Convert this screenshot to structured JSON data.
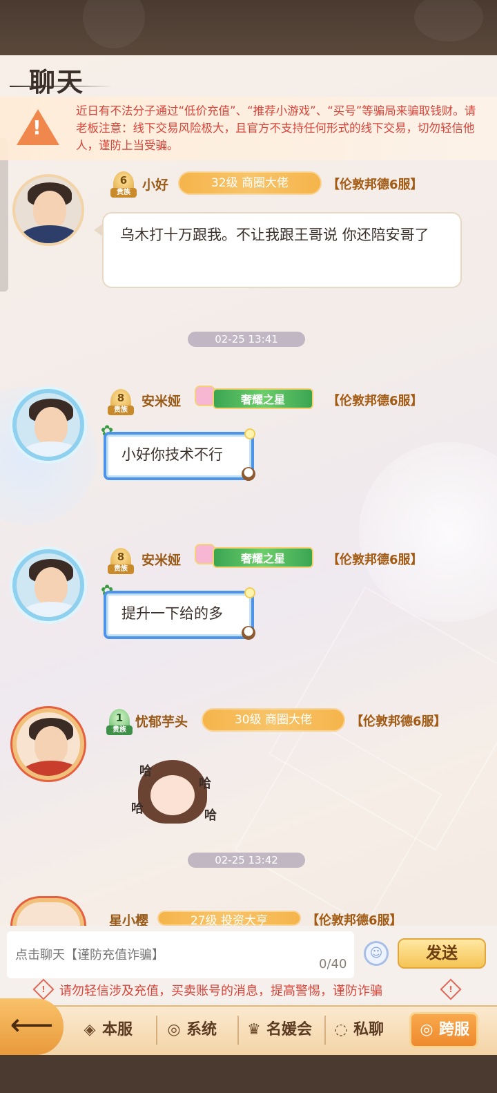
{
  "header": {
    "title": "聊天"
  },
  "notice": {
    "text": "近日有不法分子通过“低价充值”、“推荐小游戏”、“买号”等骗局来骗取钱财。请老板注意：线下交易风险极大，且官方不支持任何形式的线下交易，切勿轻信他人，谨防上当受骗。"
  },
  "messages": [
    {
      "rank": "6",
      "rank_tag": "贵族",
      "name": "小好",
      "level": "32级 商圈大佬",
      "server": "【伦敦邦德6服】",
      "text": "乌木打十万跟我。不让我跟王哥说 你还陪安哥了"
    },
    {
      "rank": "8",
      "rank_tag": "贵族",
      "name": "安米娅",
      "title_badge": "奢耀之星",
      "server": "【伦敦邦德6服】",
      "text": "小好你技术不行"
    },
    {
      "rank": "8",
      "rank_tag": "贵族",
      "name": "安米娅",
      "title_badge": "奢耀之星",
      "server": "【伦敦邦德6服】",
      "text": "提升一下给的多"
    },
    {
      "rank": "1",
      "rank_tag": "贵族",
      "name": "忧郁芋头",
      "level": "30级 商圈大佬",
      "server": "【伦敦邦德6服】",
      "sticker": "哈"
    },
    {
      "name": "星小樱",
      "level": "27级 投资大亨",
      "server": "【伦敦邦德6服】"
    }
  ],
  "timestamps": [
    "02-25 13:41",
    "02-25 13:42"
  ],
  "input": {
    "placeholder": "点击聊天【谨防充值诈骗】",
    "counter": "0/40",
    "send_label": "发送",
    "emoji_icon": "smile-icon"
  },
  "warning": {
    "text": "请勿轻信涉及充值，买卖账号的消息，提高警惕，谨防诈骗"
  },
  "tabs": [
    {
      "label": "本服",
      "icon": "diamond-icon"
    },
    {
      "label": "系统",
      "icon": "globe-icon"
    },
    {
      "label": "名媛会",
      "icon": "crown-icon"
    },
    {
      "label": "私聊",
      "icon": "chat-icon"
    },
    {
      "label": "跨服",
      "icon": "globe-icon",
      "active": true
    }
  ],
  "colors": {
    "accent": "#f5b44a",
    "warning_red": "#d9443a",
    "bubble_blue": "#4e93e6"
  }
}
